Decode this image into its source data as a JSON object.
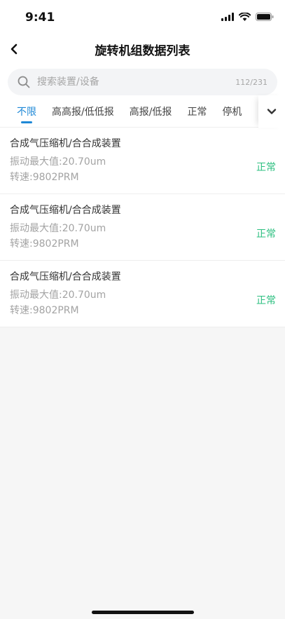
{
  "status_bar": {
    "time": "9:41",
    "icons": [
      "cellular-signal-icon",
      "wifi-icon",
      "battery-icon"
    ]
  },
  "nav": {
    "back_icon": "chevron-left-icon",
    "title": "旋转机组数据列表"
  },
  "search": {
    "icon": "search-icon",
    "placeholder": "搜索装置/设备",
    "value": "",
    "count": "112/231"
  },
  "tabs": {
    "items": [
      {
        "label": "不限",
        "active": true
      },
      {
        "label": "高高报/低低报",
        "active": false
      },
      {
        "label": "高报/低报",
        "active": false
      },
      {
        "label": "正常",
        "active": false
      },
      {
        "label": "停机",
        "active": false
      }
    ],
    "toggle_icon": "chevron-down-icon"
  },
  "list": {
    "items": [
      {
        "title": "合成气压缩机/合合成装置",
        "vibration": "振动最大值:20.70um",
        "speed": "转速:9802PRM",
        "status": "正常"
      },
      {
        "title": "合成气压缩机/合合成装置",
        "vibration": "振动最大值:20.70um",
        "speed": "转速:9802PRM",
        "status": "正常"
      },
      {
        "title": "合成气压缩机/合合成装置",
        "vibration": "振动最大值:20.70um",
        "speed": "转速:9802PRM",
        "status": "正常"
      }
    ]
  },
  "colors": {
    "accent": "#1e88d6",
    "status_normal": "#2bbf7f",
    "background": "#f6f6f6"
  }
}
